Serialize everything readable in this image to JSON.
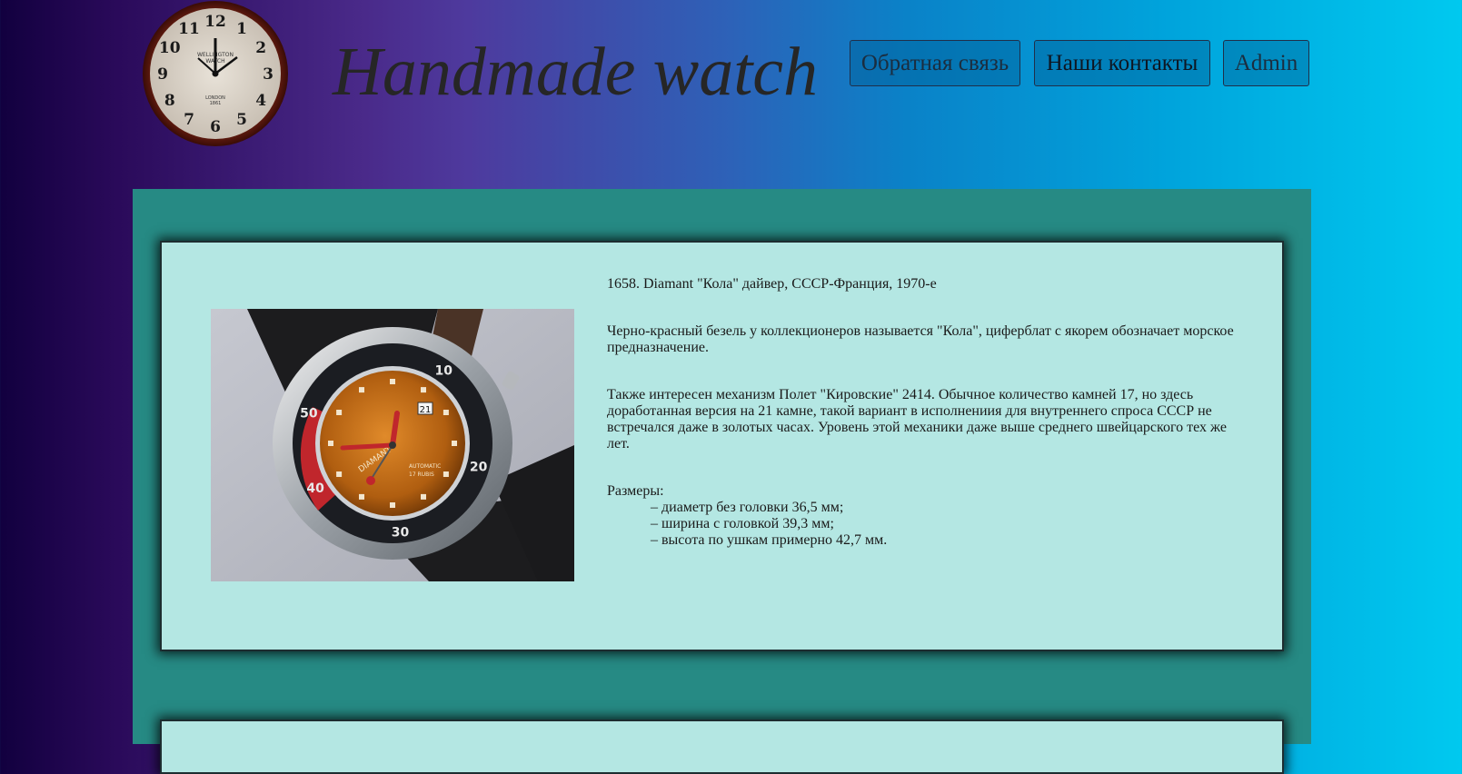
{
  "header": {
    "title": "Handmade watch",
    "nav": [
      "Обратная связь",
      "Наши контакты",
      "Admin"
    ],
    "logo_text": [
      "WELLINGTON",
      "WATCH",
      "LONDON",
      "1861"
    ],
    "logo_numerals": [
      "12",
      "1",
      "2",
      "3",
      "4",
      "5",
      "6",
      "7",
      "8",
      "9",
      "10",
      "11"
    ]
  },
  "product": {
    "title": "1658. Diamant \"Кола\" дайвер, СССР-Франция, 1970-е",
    "para1": "Черно-красный безель у коллекционеров называется \"Кола\", циферблат с якорем обозначает морское предназначение.",
    "para2": "Также интересен механизм Полет \"Кировские\" 2414. Обычное количество камней 17, но здесь доработанная версия на 21 камне, такой вариант в исполнениия для внутреннего спроса СССР не встречался даже в золотых часах. Уровень этой механики даже выше среднего швейцарского тех же лет.",
    "sizes_label": "Размеры:",
    "sizes": [
      "– диаметр без головки 36,5 мм;",
      "– ширина с головкой 39,3 мм;",
      "– высота по ушкам примерно 42,7 мм."
    ],
    "watch_brand": "DIAMANT",
    "watch_sub": "AUTOMATIC",
    "watch_jewels": "17 RUBIS",
    "watch_date": "21",
    "bezel_labels": [
      "10",
      "20",
      "30",
      "40",
      "50"
    ]
  },
  "colors": {
    "section_bg": "#268a84",
    "card_bg": "#b4e7e3",
    "dial": "#c06a1a",
    "bezel_red": "#c0262c"
  }
}
